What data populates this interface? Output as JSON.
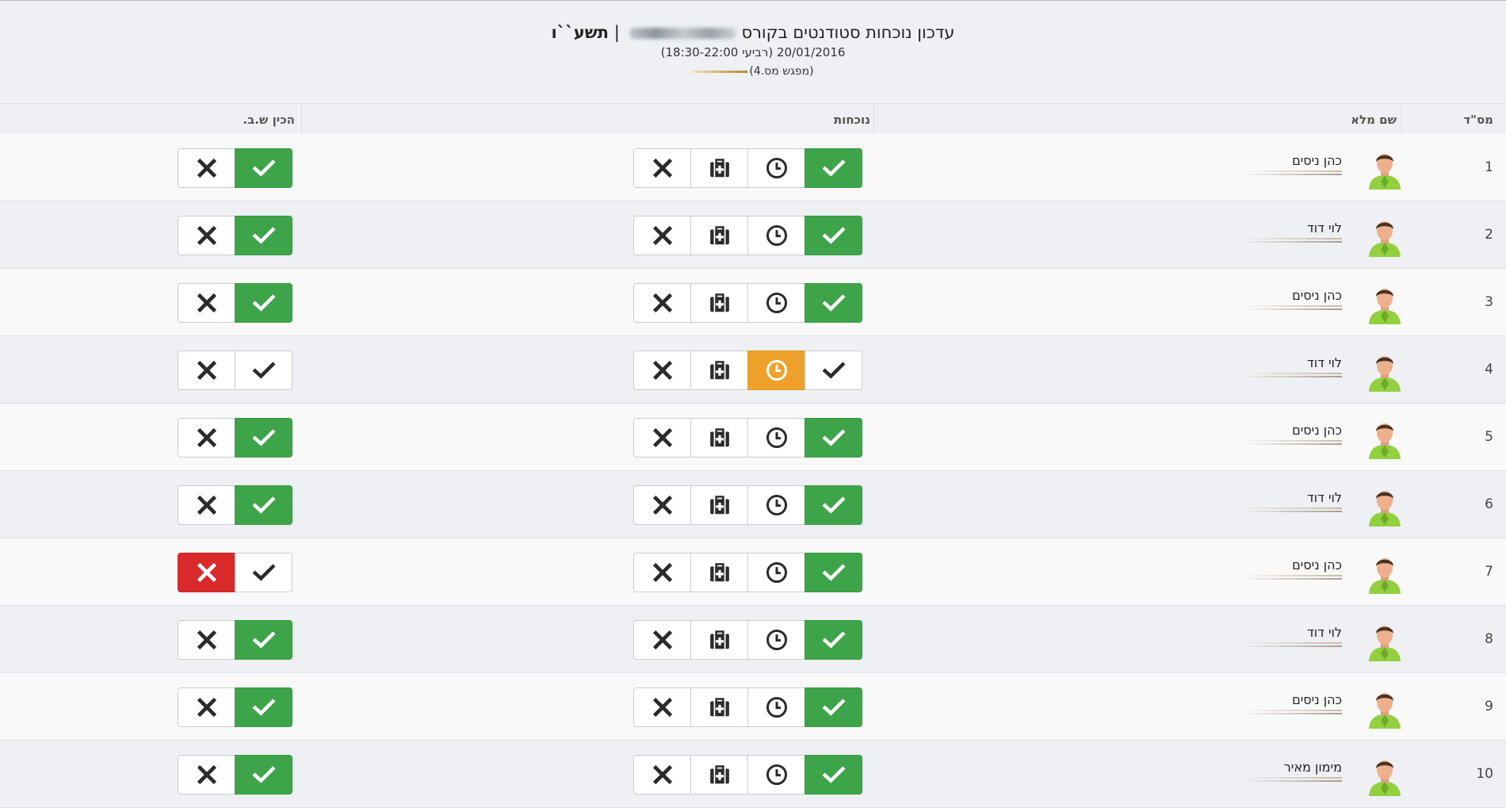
{
  "header": {
    "title_prefix": "עדכון נוכחות סטודנטים בקורס",
    "title_separator": "|",
    "title_year": "תשע``ו",
    "date_line": "20/01/2016 (רביעי 18:30-22:00)",
    "meeting_line": "(מפגש מס.4)"
  },
  "columns": {
    "num": "מס\"ד",
    "name": "שם מלא",
    "attendance": "נוכחות",
    "homework": "הכין ש.ב."
  },
  "colors": {
    "green": "#3ea44a",
    "orange": "#eea12a",
    "red": "#d9292b",
    "icon_dark": "#2b2b2b"
  },
  "attendance_states": [
    "present",
    "late",
    "sick",
    "absent"
  ],
  "homework_states": [
    "done",
    "not_done"
  ],
  "rows": [
    {
      "num": "1",
      "name": "כהן ניסים",
      "attendance": "present",
      "homework": "done"
    },
    {
      "num": "2",
      "name": "לוי דוד",
      "attendance": "present",
      "homework": "done"
    },
    {
      "num": "3",
      "name": "כהן ניסים",
      "attendance": "present",
      "homework": "done"
    },
    {
      "num": "4",
      "name": "לוי דוד",
      "attendance": "late",
      "homework": "none"
    },
    {
      "num": "5",
      "name": "כהן ניסים",
      "attendance": "present",
      "homework": "done"
    },
    {
      "num": "6",
      "name": "לוי דוד",
      "attendance": "present",
      "homework": "done"
    },
    {
      "num": "7",
      "name": "כהן ניסים",
      "attendance": "present",
      "homework": "not_done"
    },
    {
      "num": "8",
      "name": "לוי דוד",
      "attendance": "present",
      "homework": "done"
    },
    {
      "num": "9",
      "name": "כהן ניסים",
      "attendance": "present",
      "homework": "done"
    },
    {
      "num": "10",
      "name": "מימון מאיר",
      "attendance": "present",
      "homework": "done"
    }
  ]
}
